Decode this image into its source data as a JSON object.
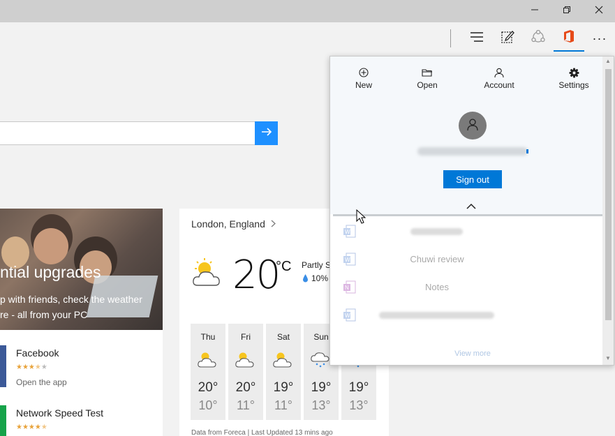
{
  "window": {
    "controls": [
      {
        "name": "minimize",
        "icon": "minimize-icon"
      },
      {
        "name": "restore",
        "icon": "restore-icon"
      },
      {
        "name": "close",
        "icon": "close-icon"
      }
    ]
  },
  "toolbar": {
    "buttons": [
      {
        "name": "hub",
        "icon": "hub-icon"
      },
      {
        "name": "web-note",
        "icon": "web-note-icon"
      },
      {
        "name": "share",
        "icon": "share-icon"
      },
      {
        "name": "office",
        "icon": "office-icon",
        "active": true
      },
      {
        "name": "more",
        "icon": "more-icon",
        "label": "···"
      }
    ],
    "accent": "#0078d7",
    "office_color": "#e64a19"
  },
  "search": {
    "value": "",
    "placeholder": "",
    "go_icon": "arrow-right-icon",
    "accent": "#1e90ff"
  },
  "hero": {
    "title": "ntial upgrades",
    "subtitle_line1": "p with friends, check the weather",
    "subtitle_line2": "re - all from your PC"
  },
  "apps": [
    {
      "name": "Facebook",
      "rating": 3.5,
      "action": "Open the app",
      "tile_color": "#3b5998"
    },
    {
      "name": "Network Speed Test",
      "rating": 4.5,
      "action": "",
      "tile_color": "#16a34a"
    }
  ],
  "weather": {
    "location": "London, England",
    "location_chevron": ">",
    "temp": "20",
    "unit": "°C",
    "condition": "Partly S",
    "precip": "10%",
    "forecast": [
      {
        "day": "Thu",
        "hi": "20°",
        "lo": "10°",
        "icon": "partly-sunny-icon"
      },
      {
        "day": "Fri",
        "hi": "20°",
        "lo": "11°",
        "icon": "partly-sunny-icon"
      },
      {
        "day": "Sat",
        "hi": "19°",
        "lo": "11°",
        "icon": "partly-sunny-icon"
      },
      {
        "day": "Sun",
        "hi": "19°",
        "lo": "13°",
        "icon": "rain-icon"
      },
      {
        "day": "",
        "hi": "19°",
        "lo": "13°",
        "icon": "rain-icon"
      }
    ],
    "footer": "Data from Foreca | Last Updated 13 mins ago"
  },
  "office_panel": {
    "actions": [
      {
        "label": "New",
        "icon": "plus-circle-icon"
      },
      {
        "label": "Open",
        "icon": "folder-open-icon"
      },
      {
        "label": "Account",
        "icon": "person-icon"
      },
      {
        "label": "Settings",
        "icon": "gear-icon"
      }
    ],
    "sign_out": "Sign out",
    "documents": [
      {
        "name": "",
        "app": "word"
      },
      {
        "name": "Chuwi review",
        "app": "word"
      },
      {
        "name": "Notes",
        "app": "onenote"
      },
      {
        "name": "",
        "app": "word"
      }
    ],
    "view_more": "View more"
  }
}
